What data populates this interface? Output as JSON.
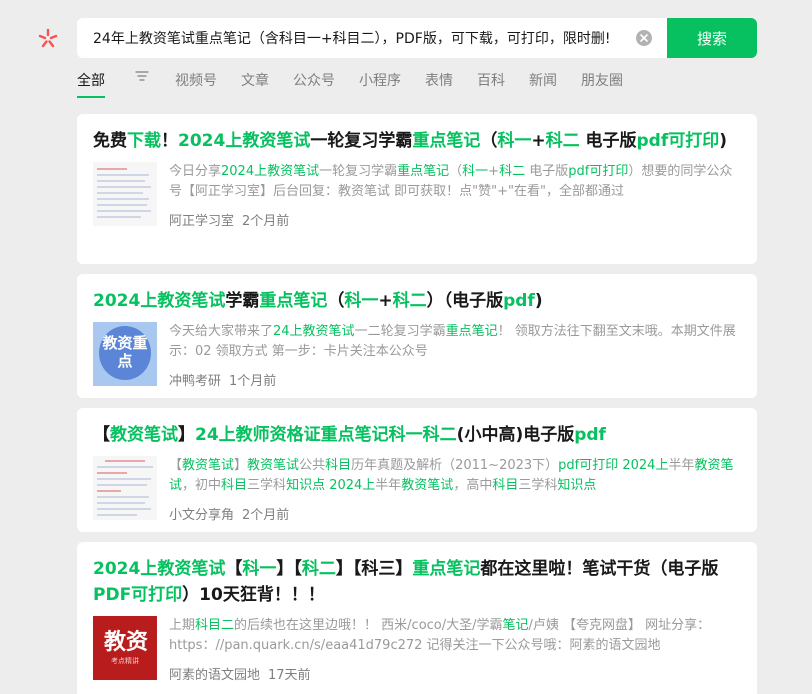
{
  "search": {
    "query": "24年上教资笔试重点笔记（含科目一+科目二），PDF版，可下载，可打印，限时删!",
    "button_label": "搜索"
  },
  "tabs": [
    "全部",
    "视频号",
    "文章",
    "公众号",
    "小程序",
    "表情",
    "百科",
    "新闻",
    "朋友圈"
  ],
  "results": [
    {
      "title_parts": [
        {
          "t": "免费",
          "h": false
        },
        {
          "t": "下载",
          "h": true
        },
        {
          "t": "！",
          "h": false
        },
        {
          "t": "2024上教资笔试",
          "h": true
        },
        {
          "t": "一轮复习学霸",
          "h": false
        },
        {
          "t": "重点笔记",
          "h": true
        },
        {
          "t": "（",
          "h": false
        },
        {
          "t": "科一",
          "h": true
        },
        {
          "t": "+",
          "h": false
        },
        {
          "t": "科二",
          "h": true
        },
        {
          "t": " 电子版",
          "h": false
        },
        {
          "t": "pdf可打印",
          "h": true
        },
        {
          "t": ")",
          "h": false
        }
      ],
      "desc_parts": [
        {
          "t": "今日分享",
          "h": false
        },
        {
          "t": "2024上教资笔试",
          "h": true
        },
        {
          "t": "一轮复习学霸",
          "h": false
        },
        {
          "t": "重点笔记",
          "h": true
        },
        {
          "t": "（",
          "h": false
        },
        {
          "t": "科一",
          "h": true
        },
        {
          "t": "+",
          "h": false
        },
        {
          "t": "科二",
          "h": true
        },
        {
          "t": " 电子版",
          "h": false
        },
        {
          "t": "pdf可打印",
          "h": true
        },
        {
          "t": "）想要的同学公众号【阿正学习室】后台回复：教资笔试 即可获取！点\"赞\"+\"在看\"，全部都通过",
          "h": false
        }
      ],
      "source": "阿正学习室",
      "time": "2个月前",
      "thumb": "doc"
    },
    {
      "title_parts": [
        {
          "t": "2024上教资笔试",
          "h": true
        },
        {
          "t": "学霸",
          "h": false
        },
        {
          "t": "重点笔记",
          "h": true
        },
        {
          "t": "（",
          "h": false
        },
        {
          "t": "科一",
          "h": true
        },
        {
          "t": "+",
          "h": false
        },
        {
          "t": "科二",
          "h": true
        },
        {
          "t": "）（电子版",
          "h": false
        },
        {
          "t": "pdf",
          "h": true
        },
        {
          "t": ")",
          "h": false
        }
      ],
      "desc_parts": [
        {
          "t": "今天给大家带来了",
          "h": false
        },
        {
          "t": "24上教资笔试",
          "h": true
        },
        {
          "t": "一二轮复习学霸",
          "h": false
        },
        {
          "t": "重点笔记",
          "h": true
        },
        {
          "t": "！ 领取方法往下翻至文末哦。本期文件展示：02 领取方式 第一步：卡片关注本公众号",
          "h": false
        }
      ],
      "source": "冲鸭考研",
      "time": "1个月前",
      "thumb": "blue",
      "thumb_text": "教资重点"
    },
    {
      "title_parts": [
        {
          "t": "【",
          "h": false
        },
        {
          "t": "教资笔试",
          "h": true
        },
        {
          "t": "】",
          "h": false
        },
        {
          "t": "24上教师资格证重点笔记科一科二",
          "h": true
        },
        {
          "t": "(小中高)电子版",
          "h": false
        },
        {
          "t": "pdf",
          "h": true
        }
      ],
      "desc_parts": [
        {
          "t": "【",
          "h": false
        },
        {
          "t": "教资笔试",
          "h": true
        },
        {
          "t": "】",
          "h": false
        },
        {
          "t": "教资笔试",
          "h": true
        },
        {
          "t": "公共",
          "h": false
        },
        {
          "t": "科目",
          "h": true
        },
        {
          "t": "历年真题及解析（2011~2023下）",
          "h": false
        },
        {
          "t": "pdf可打印 2024上",
          "h": true
        },
        {
          "t": "半年",
          "h": false
        },
        {
          "t": "教资笔试",
          "h": true
        },
        {
          "t": "，初中",
          "h": false
        },
        {
          "t": "科目",
          "h": true
        },
        {
          "t": "三学科",
          "h": false
        },
        {
          "t": "知识点 2024上",
          "h": true
        },
        {
          "t": "半年",
          "h": false
        },
        {
          "t": "教资笔试",
          "h": true
        },
        {
          "t": "，高中",
          "h": false
        },
        {
          "t": "科目",
          "h": true
        },
        {
          "t": "三学科",
          "h": false
        },
        {
          "t": "知识点",
          "h": true
        }
      ],
      "source": "小文分享角",
      "time": "2个月前",
      "thumb": "doc"
    },
    {
      "title_parts": [
        {
          "t": "2024上教资笔试",
          "h": true
        },
        {
          "t": "【",
          "h": false
        },
        {
          "t": "科一",
          "h": true
        },
        {
          "t": "】【",
          "h": false
        },
        {
          "t": "科二",
          "h": true
        },
        {
          "t": "】【科三】",
          "h": false
        },
        {
          "t": "重点笔记",
          "h": true
        },
        {
          "t": "都在这里啦！笔试干货（电子版",
          "h": false
        },
        {
          "t": "PDF可打印",
          "h": true
        },
        {
          "t": "）10天狂背！！！",
          "h": false
        }
      ],
      "desc_parts": [
        {
          "t": "上期",
          "h": false
        },
        {
          "t": "科目二",
          "h": true
        },
        {
          "t": "的后续也在这里边哦！！ 西米/coco/大圣/学霸",
          "h": false
        },
        {
          "t": "笔记",
          "h": true
        },
        {
          "t": "/卢姨 【夸克网盘】 网址分享：https：//pan.quark.cn/s/eaa41d79c272 记得关注一下公众号哦：阿素的语文园地",
          "h": false
        }
      ],
      "source": "阿素的语文园地",
      "time": "17天前",
      "thumb": "red",
      "thumb_text": "教资",
      "thumb_sub": "考点精讲"
    }
  ],
  "colors": {
    "accent": "#07c160",
    "logo": "#fa5151",
    "page_bg": "#ededed"
  }
}
